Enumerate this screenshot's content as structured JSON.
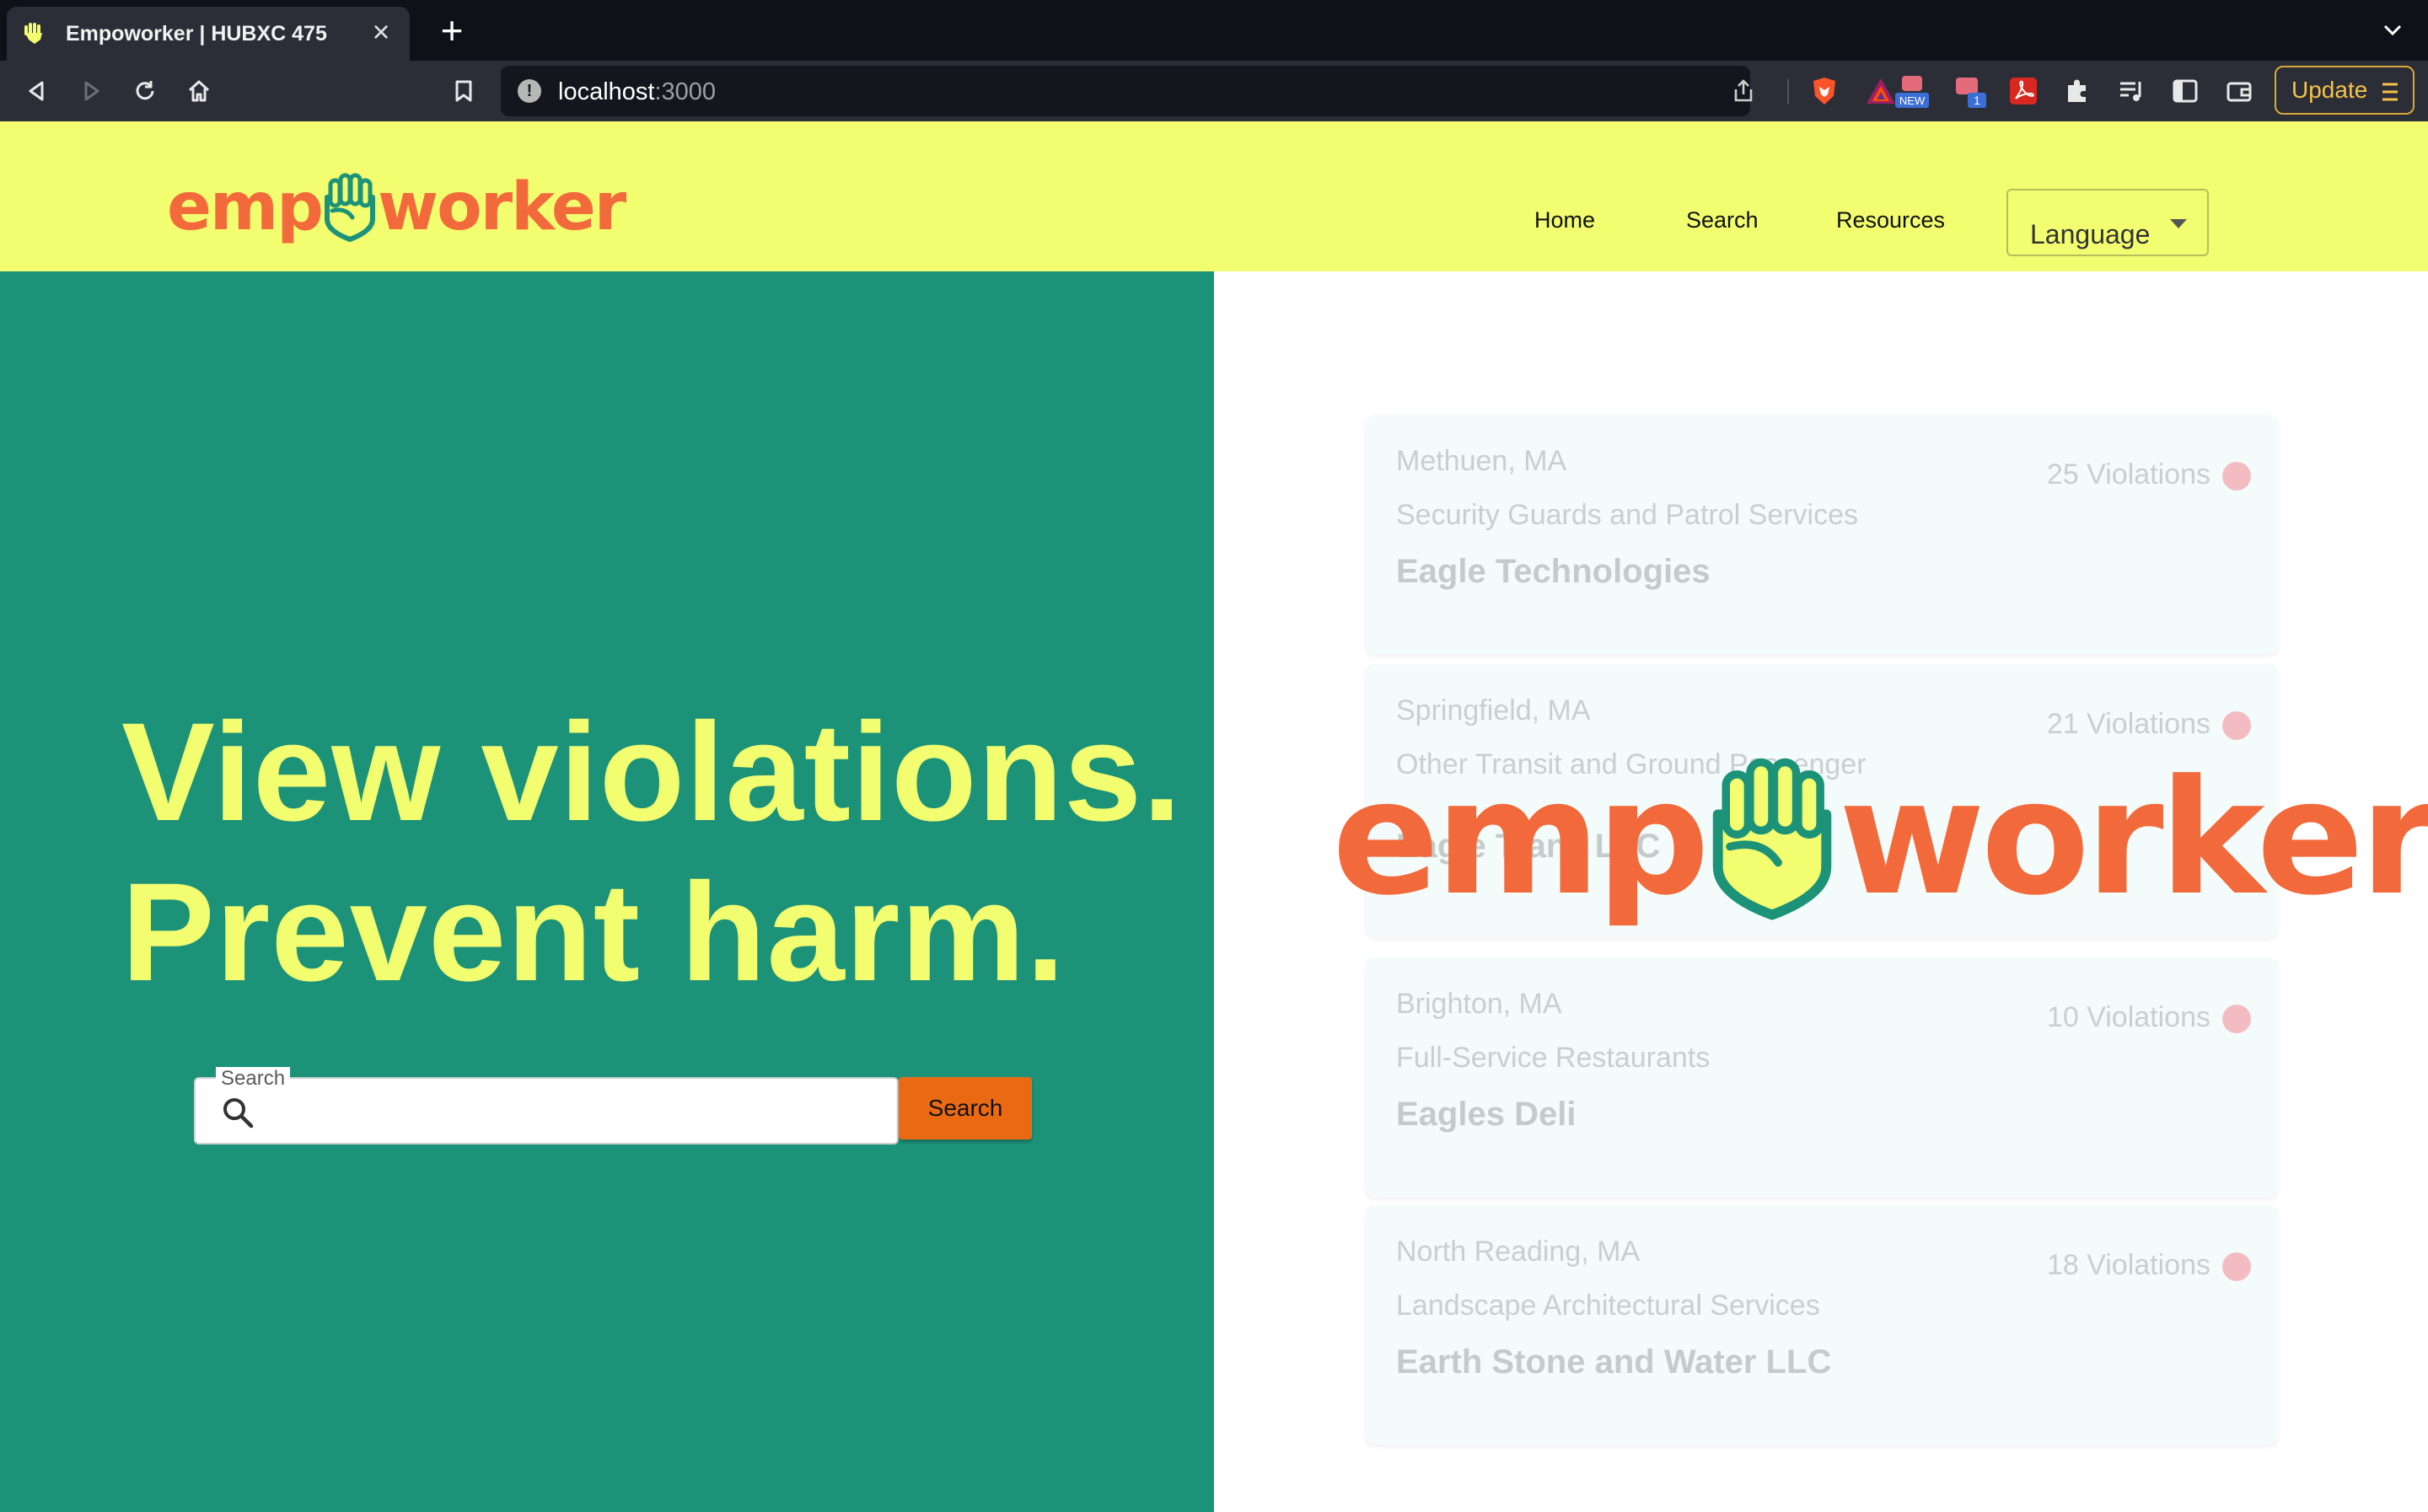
{
  "browser": {
    "tab_title": "Empoworker | HUBXC 475",
    "url_host": "localhost",
    "url_port": ":3000",
    "update_label": "Update",
    "extension_badge_new": "NEW",
    "extension_badge_count": "1",
    "icons": [
      "hand-favicon-icon",
      "close-icon",
      "plus-icon",
      "chevron-down-icon",
      "back-icon",
      "forward-icon",
      "reload-icon",
      "home-icon",
      "bookmark-icon",
      "info-icon",
      "share-icon",
      "brave-shield-icon",
      "bat-rewards-icon",
      "extension-new-icon",
      "extension-count-icon",
      "pdf-icon",
      "puzzle-icon",
      "playlist-icon",
      "sidebar-icon",
      "wallet-icon",
      "hamburger-icon"
    ]
  },
  "header": {
    "logo_left": "emp",
    "logo_right": "worker",
    "nav": {
      "home": "Home",
      "search": "Search",
      "resources": "Resources"
    },
    "language_label": "Language"
  },
  "hero": {
    "line1": "View violations.",
    "line2": "Prevent harm.",
    "search_label": "Search",
    "search_placeholder": "",
    "search_button": "Search"
  },
  "cards": [
    {
      "location": "Methuen, MA",
      "industry": "Security Guards and Patrol Services",
      "name": "Eagle Technologies",
      "violations": "25 Violations"
    },
    {
      "location": "Springfield, MA",
      "industry": "Other Transit and Ground Passenger",
      "name": "Eagle Trans LLC",
      "violations": "21 Violations"
    },
    {
      "location": "Brighton, MA",
      "industry": "Full-Service Restaurants",
      "name": "Eagles Deli",
      "violations": "10 Violations"
    },
    {
      "location": "North Reading, MA",
      "industry": "Landscape Architectural Services",
      "name": "Earth Stone and Water LLC",
      "violations": "18 Violations"
    }
  ],
  "overlay_logo": {
    "left": "emp",
    "right": "worker"
  },
  "colors": {
    "brand_orange": "#f26a3b",
    "brand_yellow": "#f2fd6f",
    "brand_green": "#1c9379",
    "search_button": "#ea6a14",
    "violation_dot": "#f3bcc2"
  }
}
